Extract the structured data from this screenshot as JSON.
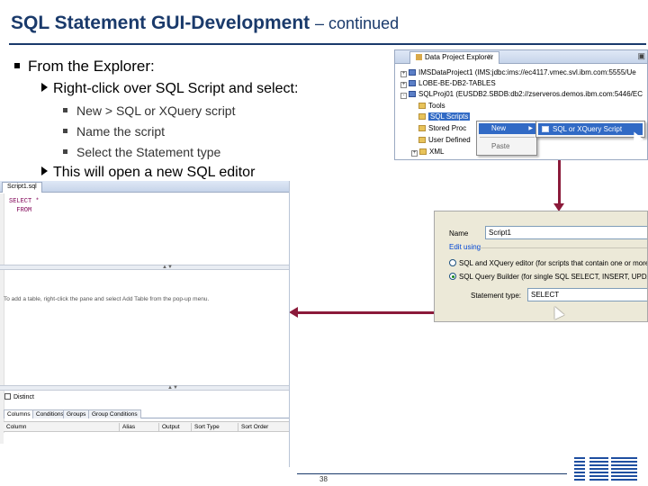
{
  "slide": {
    "title_main": "SQL Statement GUI-Development",
    "title_suffix": "– continued",
    "bullet_l1": "From the Explorer:",
    "bullet_l2_a": "Right-click over SQL Script and select:",
    "sub_bullets": [
      "New  >  SQL or XQuery script",
      "Name the script",
      "Select the Statement type"
    ],
    "bullet_l2_b": "This will open a new SQL editor",
    "page_number": "38"
  },
  "explorer": {
    "tab_label": "Data Project Explorer",
    "close_glyph": "x",
    "tree": [
      "IMSDataProject1 (IMS:jdbc:ims://ec4117.vmec.svl.ibm.com:5555/Ue",
      "LOBE-BE-DB2-TABLES",
      "SQLProj01 (EUSDB2.SBDB:db2://zserveros.demos.ibm.com:5446/EC",
      "Tools",
      "SQL Scripts",
      "Stored Proc",
      "User Defined",
      "XML"
    ],
    "context_menu": {
      "new_label": "New",
      "paste_label": "Paste"
    },
    "submenu": {
      "item_label": "SQL or XQuery Script"
    }
  },
  "wizard": {
    "name_label": "Name",
    "name_value": "Script1",
    "edit_using_label": "Edit using",
    "option1": "SQL and XQuery editor (for scripts that contain one or more",
    "option2": "SQL Query Builder (for single SQL SELECT, INSERT, UPDAT",
    "statement_type_label": "Statement type:",
    "statement_type_value": "SELECT"
  },
  "editor": {
    "tab_label": "Script1.sql",
    "code_line1": "SELECT *",
    "code_line2": "  FROM",
    "hint_text": "To add a table, right-click the pane and select Add Table from the pop-up menu.",
    "checkbox_label": "Distinct",
    "bottom_tabs": [
      "Columns",
      "Conditions",
      "Groups",
      "Group Conditions"
    ],
    "grid_headers": [
      "Column",
      "Alias",
      "Output",
      "Sort Type",
      "Sort Order"
    ]
  },
  "branding": {
    "logo_text": "IBM",
    "accent_color": "#1a3a6b",
    "arrow_color": "#8b1a3a"
  }
}
